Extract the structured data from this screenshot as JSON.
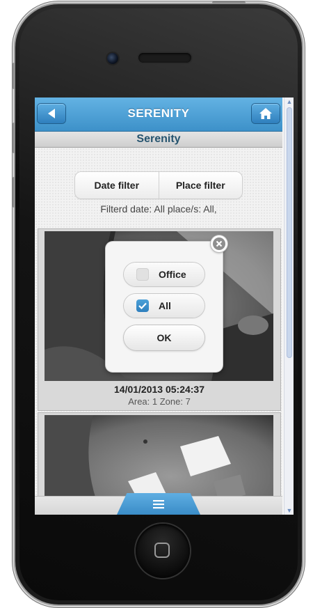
{
  "header": {
    "title": "SERENITY",
    "back_icon": "back-arrow-icon",
    "home_icon": "home-icon"
  },
  "subheader": {
    "title": "Serenity"
  },
  "filters": {
    "date_label": "Date filter",
    "place_label": "Place filter",
    "info": "Filterd date: All place/s: All,"
  },
  "events": [
    {
      "timestamp": "14/01/2013 05:24:37",
      "location": "Area: 1 Zone: 7"
    }
  ],
  "place_popup": {
    "options": [
      {
        "label": "Office",
        "checked": false
      },
      {
        "label": "All",
        "checked": true
      }
    ],
    "ok_label": "OK",
    "close_icon": "close-icon"
  },
  "footer": {
    "menu_icon": "menu-icon"
  },
  "colors": {
    "accent": "#3d91c9",
    "subheader_text": "#26546f"
  }
}
